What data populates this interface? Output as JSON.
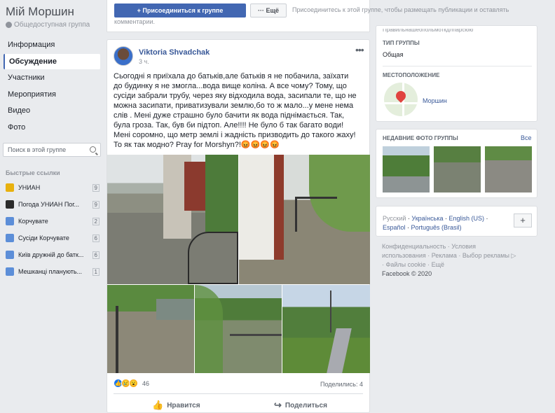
{
  "group": {
    "title": "Мій Моршин",
    "privacy": "Общедоступная группа"
  },
  "nav": [
    {
      "label": "Информация",
      "selected": false
    },
    {
      "label": "Обсуждение",
      "selected": true
    },
    {
      "label": "Участники",
      "selected": false
    },
    {
      "label": "Мероприятия",
      "selected": false
    },
    {
      "label": "Видео",
      "selected": false
    },
    {
      "label": "Фото",
      "selected": false
    }
  ],
  "search": {
    "placeholder": "Поиск в этой группе"
  },
  "quick_links": {
    "heading": "Быстрые ссылки",
    "items": [
      {
        "label": "УНИАН",
        "count": "9",
        "color": "#e8b10e"
      },
      {
        "label": "Погода УНИАН Пог...",
        "count": "9",
        "color": "#2b2b2b"
      },
      {
        "label": "Корчувате",
        "count": "2",
        "color": "#5c8ed8"
      },
      {
        "label": "Сусіди Корчувате",
        "count": "6",
        "color": "#5c8ed8"
      },
      {
        "label": "Київ дружній до батк...",
        "count": "6",
        "color": "#5c8ed8"
      },
      {
        "label": "Мешканці планують...",
        "count": "1",
        "color": "#5c8ed8"
      }
    ]
  },
  "join": {
    "button": "+ Присоединиться к группе",
    "more": "Ещё",
    "hint_line1": "Присоединитесь к этой группе, чтобы размещать публикации и оставлять",
    "hint_line2": "комментарии."
  },
  "post": {
    "author": "Viktoria Shvadchak",
    "time": "3 ч.",
    "text": "Сьогодні я приїхала до батьків,але батьків я не побачила, заїхати до будинку я не змогла...вода вище коліна. А все чому? Тому, що сусіди забрали трубу, через яку відходила вода, засипали те, що не можна засипати, приватизували землю,бо то ж мало...у мене нема слів . Мені дуже страшно було бачити як вода піднімається. Так, була гроза. Так, був би підтоп. Але!!!! Не було б так багато води! Мені соромно, що метр землі і жадність призводить до такого жаху! То як так модно? Pray for Morshyn?!😡😡😡😡",
    "reactions_count": "46",
    "shares": "Поделились: 4",
    "like": "Нравится",
    "share": "Поделиться"
  },
  "right": {
    "cut_text": "Правильнашеопольмоткдлпарсюю",
    "type_label": "ТИП ГРУППЫ",
    "type_value": "Общая",
    "location_label": "МЕСТОПОЛОЖЕНИЕ",
    "location_value": "Моршин",
    "photos_label": "НЕДАВНИЕ ФОТО ГРУППЫ",
    "photos_all": "Все",
    "languages": {
      "active": "Русский",
      "others": [
        "Українська",
        "English (US)",
        "Español",
        "Português (Brasil)"
      ],
      "add": "+"
    },
    "footer": {
      "line1": "Конфиденциальность · Условия",
      "line2": "использования · Реклама · Выбор рекламы",
      "line3": "· Файлы cookie · Ещё",
      "line4": "Facebook © 2020"
    }
  }
}
